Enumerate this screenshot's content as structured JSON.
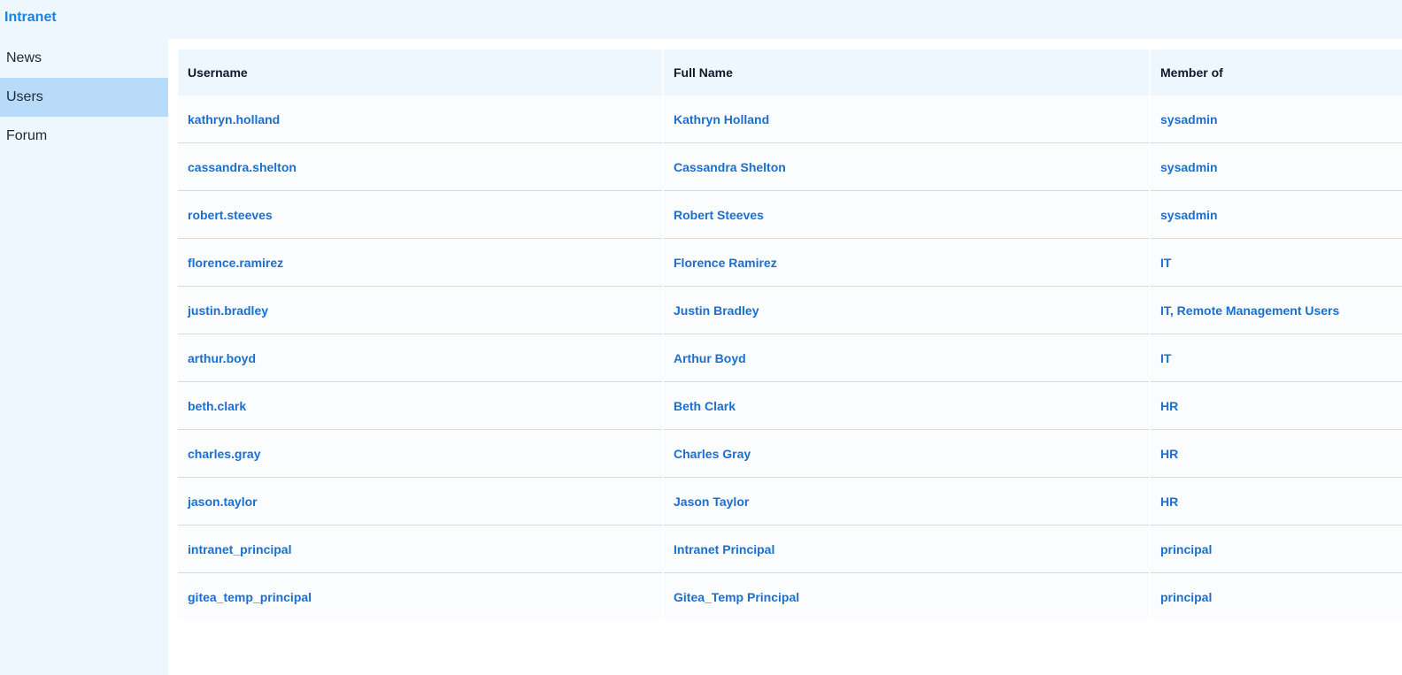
{
  "app": {
    "title": "Intranet"
  },
  "sidebar": {
    "items": [
      {
        "label": "News",
        "active": false
      },
      {
        "label": "Users",
        "active": true
      },
      {
        "label": "Forum",
        "active": false
      }
    ]
  },
  "table": {
    "columns": [
      "Username",
      "Full Name",
      "Member of"
    ],
    "rows": [
      {
        "username": "kathryn.holland",
        "full_name": "Kathryn Holland",
        "member_of": "sysadmin"
      },
      {
        "username": "cassandra.shelton",
        "full_name": "Cassandra Shelton",
        "member_of": "sysadmin"
      },
      {
        "username": "robert.steeves",
        "full_name": "Robert Steeves",
        "member_of": "sysadmin"
      },
      {
        "username": "florence.ramirez",
        "full_name": "Florence Ramirez",
        "member_of": "IT"
      },
      {
        "username": "justin.bradley",
        "full_name": "Justin Bradley",
        "member_of": "IT, Remote Management Users"
      },
      {
        "username": "arthur.boyd",
        "full_name": "Arthur Boyd",
        "member_of": "IT"
      },
      {
        "username": "beth.clark",
        "full_name": "Beth Clark",
        "member_of": "HR"
      },
      {
        "username": "charles.gray",
        "full_name": "Charles Gray",
        "member_of": "HR"
      },
      {
        "username": "jason.taylor",
        "full_name": "Jason Taylor",
        "member_of": "HR"
      },
      {
        "username": "intranet_principal",
        "full_name": "Intranet Principal",
        "member_of": "principal"
      },
      {
        "username": "gitea_temp_principal",
        "full_name": "Gitea_Temp Principal",
        "member_of": "principal"
      }
    ]
  },
  "colors": {
    "accent": "#1a82df",
    "link": "#1a6fd0",
    "sidebar_bg": "#eef6fe",
    "active_item_bg": "#b7dbf8"
  }
}
